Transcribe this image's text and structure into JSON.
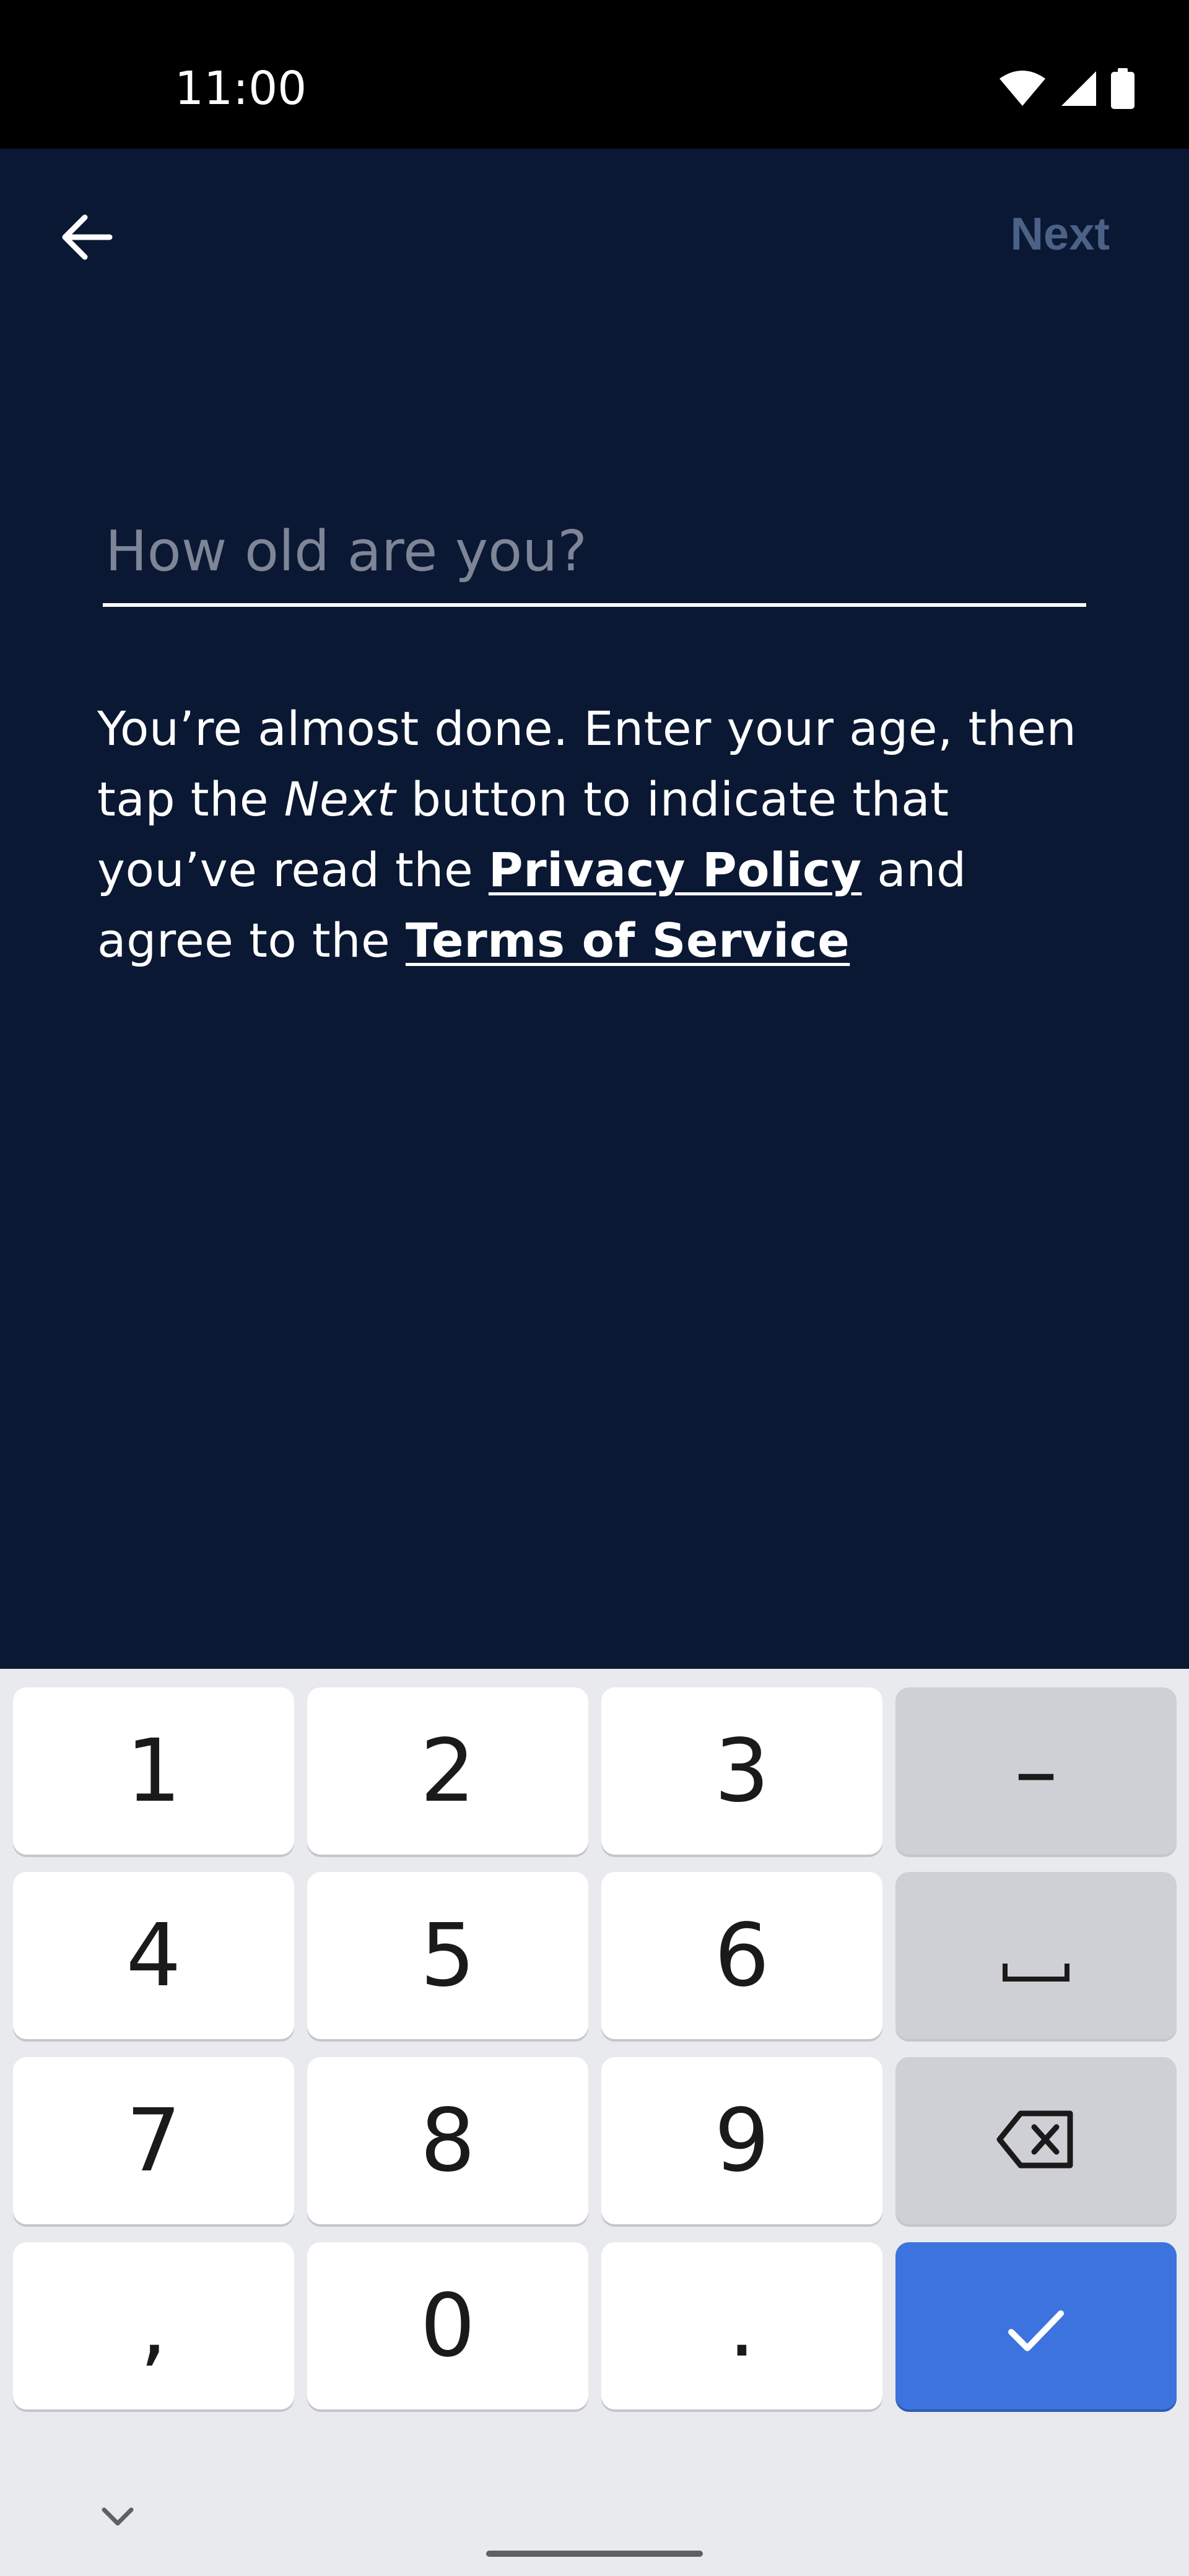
{
  "status_bar": {
    "time": "11:00",
    "icons": [
      "wifi-icon",
      "cellular-signal-icon",
      "battery-icon"
    ]
  },
  "header": {
    "back_icon": "arrow-left-icon",
    "next_label": "Next"
  },
  "age_form": {
    "placeholder": "How old are you?",
    "value": ""
  },
  "info": {
    "part1": "You’re almost done. Enter your age, then tap the ",
    "next_word": "Next",
    "part2": " button to indicate that you’ve read the ",
    "privacy_link": "Privacy Policy",
    "part3": " and agree to the ",
    "terms_link": "Terms of Service"
  },
  "keyboard": {
    "keys": {
      "k1": "1",
      "k2": "2",
      "k3": "3",
      "dash": "–",
      "k4": "4",
      "k5": "5",
      "k6": "6",
      "k7": "7",
      "k8": "8",
      "k9": "9",
      "comma": ",",
      "k0": "0",
      "period": "."
    },
    "special_icons": [
      "space-icon",
      "backspace-icon",
      "check-icon",
      "chevron-down-icon"
    ]
  },
  "colors": {
    "background": "#0a1833",
    "next_disabled": "#4b6186",
    "keyboard_bg": "#e9eaee",
    "enter_key": "#3c73df"
  }
}
